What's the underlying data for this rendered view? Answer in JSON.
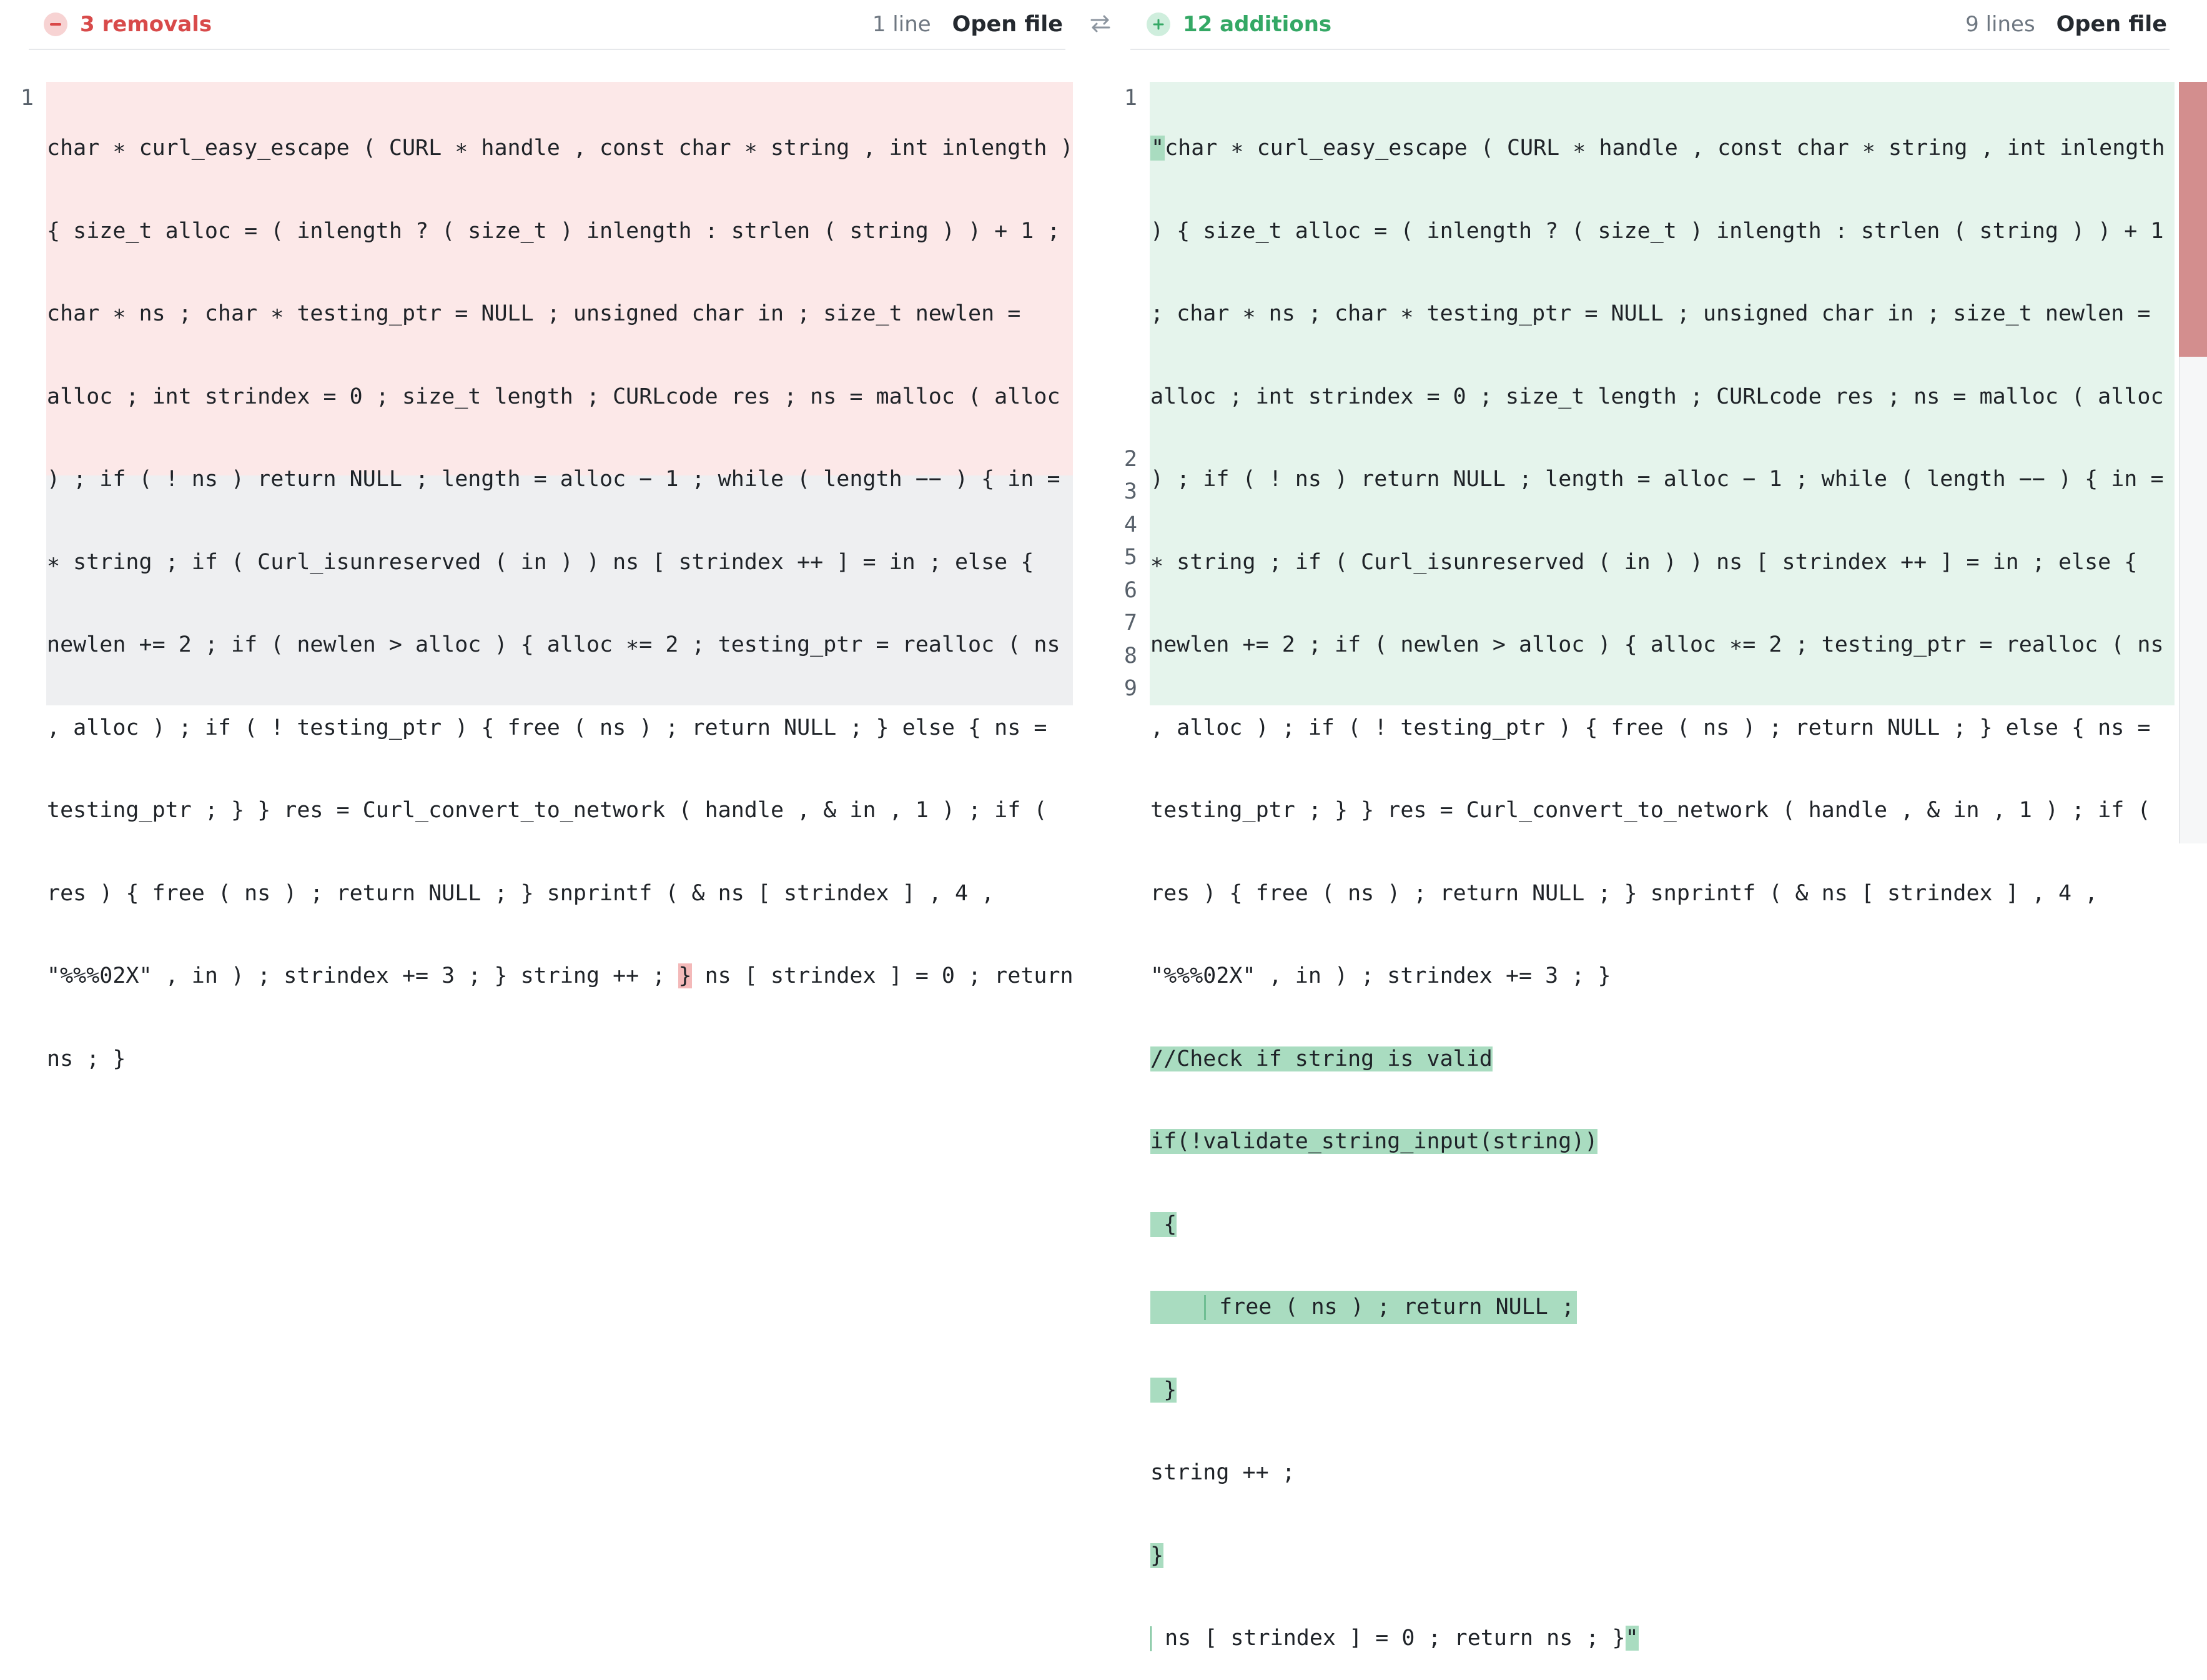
{
  "left_header": {
    "count_label": "3 removals",
    "lines_label": "1 line",
    "open_file_label": "Open file"
  },
  "right_header": {
    "count_label": "12 additions",
    "lines_label": "9 lines",
    "open_file_label": "Open file"
  },
  "colors": {
    "removed": "#d84a4a",
    "added": "#34a865",
    "removed_bg": "#fce8e8",
    "added_bg": "#e5f4ec"
  },
  "icons": {
    "left": "minus-circle-icon",
    "right": "plus-circle-icon",
    "swap": "swap-arrows-icon"
  },
  "left_code": {
    "line_numbers": [
      "1"
    ],
    "wrapped": [
      "char ∗ curl_easy_escape ( CURL ∗ handle , const char ∗ string , int inlength )",
      "{ size_t alloc = ( inlength ? ( size_t ) inlength : strlen ( string ) ) + 1 ;",
      "char ∗ ns ; char ∗ testing_ptr = NULL ; unsigned char in ; size_t newlen =",
      "alloc ; int strindex = 0 ; size_t length ; CURLcode res ; ns = malloc ( alloc",
      ") ; if ( ! ns ) return NULL ; length = alloc − 1 ; while ( length −− ) { in =",
      "∗ string ; if ( Curl_isunreserved ( in ) ) ns [ strindex ++ ] = in ; else {",
      "newlen += 2 ; if ( newlen > alloc ) { alloc ∗= 2 ; testing_ptr = realloc ( ns",
      ", alloc ) ; if ( ! testing_ptr ) { free ( ns ) ; return NULL ; } else { ns =",
      "testing_ptr ; } } res = Curl_convert_to_network ( handle , & in , 1 ) ; if (",
      "res ) { free ( ns ) ; return NULL ; } snprintf ( & ns [ strindex ] , 4 ,"
    ],
    "line11_before": "\"%%%02X\" , in ) ; strindex += 3 ; } string ++ ; ",
    "line11_removed": "}",
    "line11_after": " ns [ strindex ] = 0 ; return",
    "line12": "ns ; }"
  },
  "right_code": {
    "line_numbers": [
      "1",
      "2",
      "3",
      "4",
      "5",
      "6",
      "7",
      "8",
      "9"
    ],
    "wrapped": [
      "\"char ∗ curl_easy_escape ( CURL ∗ handle , const char ∗ string , int inlength",
      ") { size_t alloc = ( inlength ? ( size_t ) inlength : strlen ( string ) ) + 1",
      "; char ∗ ns ; char ∗ testing_ptr = NULL ; unsigned char in ; size_t newlen =",
      "alloc ; int strindex = 0 ; size_t length ; CURLcode res ; ns = malloc ( alloc",
      ") ; if ( ! ns ) return NULL ; length = alloc − 1 ; while ( length −− ) { in =",
      "∗ string ; if ( Curl_isunreserved ( in ) ) ns [ strindex ++ ] = in ; else {",
      "newlen += 2 ; if ( newlen > alloc ) { alloc ∗= 2 ; testing_ptr = realloc ( ns",
      ", alloc ) ; if ( ! testing_ptr ) { free ( ns ) ; return NULL ; } else { ns =",
      "testing_ptr ; } } res = Curl_convert_to_network ( handle , & in , 1 ) ; if (",
      "res ) { free ( ns ) ; return NULL ; } snprintf ( & ns [ strindex ] , 4 ,",
      "\"%%%02X\" , in ) ; strindex += 3 ; }"
    ],
    "line2": "//Check if string is valid",
    "line3": "if(!validate_string_input(string))",
    "line4": " {",
    "line5": " free ( ns ) ; return NULL ;",
    "line6": " }",
    "line7": "string ++ ;",
    "line8": "}",
    "line9": " ns [ strindex ] = 0 ; return ns ; }",
    "line9_end": "\""
  }
}
